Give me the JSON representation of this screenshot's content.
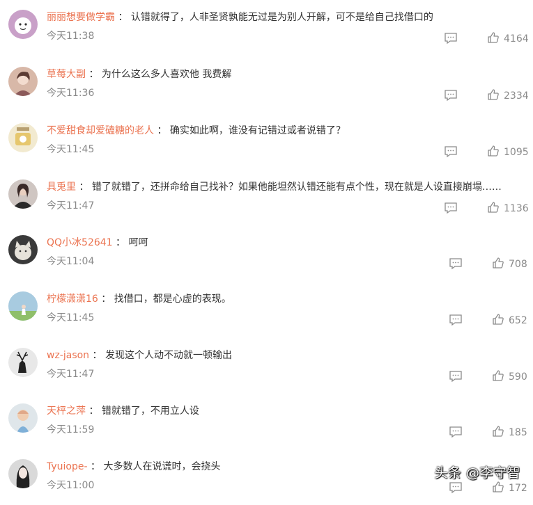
{
  "comments": [
    {
      "username": "丽丽想要做学霸",
      "text": "认错就得了，人非圣贤孰能无过是为别人开解，可不是给自己找借口的",
      "time": "今天11:38",
      "likes": "4164",
      "avatar_color": "#c9a0c8"
    },
    {
      "username": "草莓大副",
      "text": "为什么这么多人喜欢他 我费解",
      "time": "今天11:36",
      "likes": "2334",
      "avatar_color": "#d8b8a8"
    },
    {
      "username": "不爱甜食却爱磕糖的老人",
      "text": "确实如此啊，谁没有记错过或者说错了？",
      "time": "今天11:45",
      "likes": "1095",
      "avatar_color": "#f2ead0"
    },
    {
      "username": "具兎里",
      "text": "错了就错了，还拼命给自己找补？如果他能坦然认错还能有点个性，现在就是人设直接崩塌……",
      "time": "今天11:47",
      "likes": "1136",
      "avatar_color": "#6a5a58"
    },
    {
      "username": "QQ小冰52641",
      "text": "呵呵",
      "time": "今天11:04",
      "likes": "708",
      "avatar_color": "#3a3a3a"
    },
    {
      "username": "柠檬潇潇16",
      "text": "找借口，都是心虚的表现。",
      "time": "今天11:45",
      "likes": "652",
      "avatar_color": "#a8cbe0"
    },
    {
      "username": "wz-jason",
      "text": "发现这个人动不动就一顿输出",
      "time": "今天11:47",
      "likes": "590",
      "avatar_color": "#e8e8e8"
    },
    {
      "username": "天枰之萍",
      "text": "错就错了，不用立人设",
      "time": "今天11:59",
      "likes": "185",
      "avatar_color": "#dfe6ea"
    },
    {
      "username": "Tyuiope-",
      "text": "大多数人在说谎时，会挠头",
      "time": "今天11:00",
      "likes": "172",
      "avatar_color": "#d9d9d9"
    }
  ],
  "watermark": "头条 @李守智",
  "colors": {
    "username": "#eb7350",
    "text": "#333333",
    "meta": "#8a8a8a"
  }
}
